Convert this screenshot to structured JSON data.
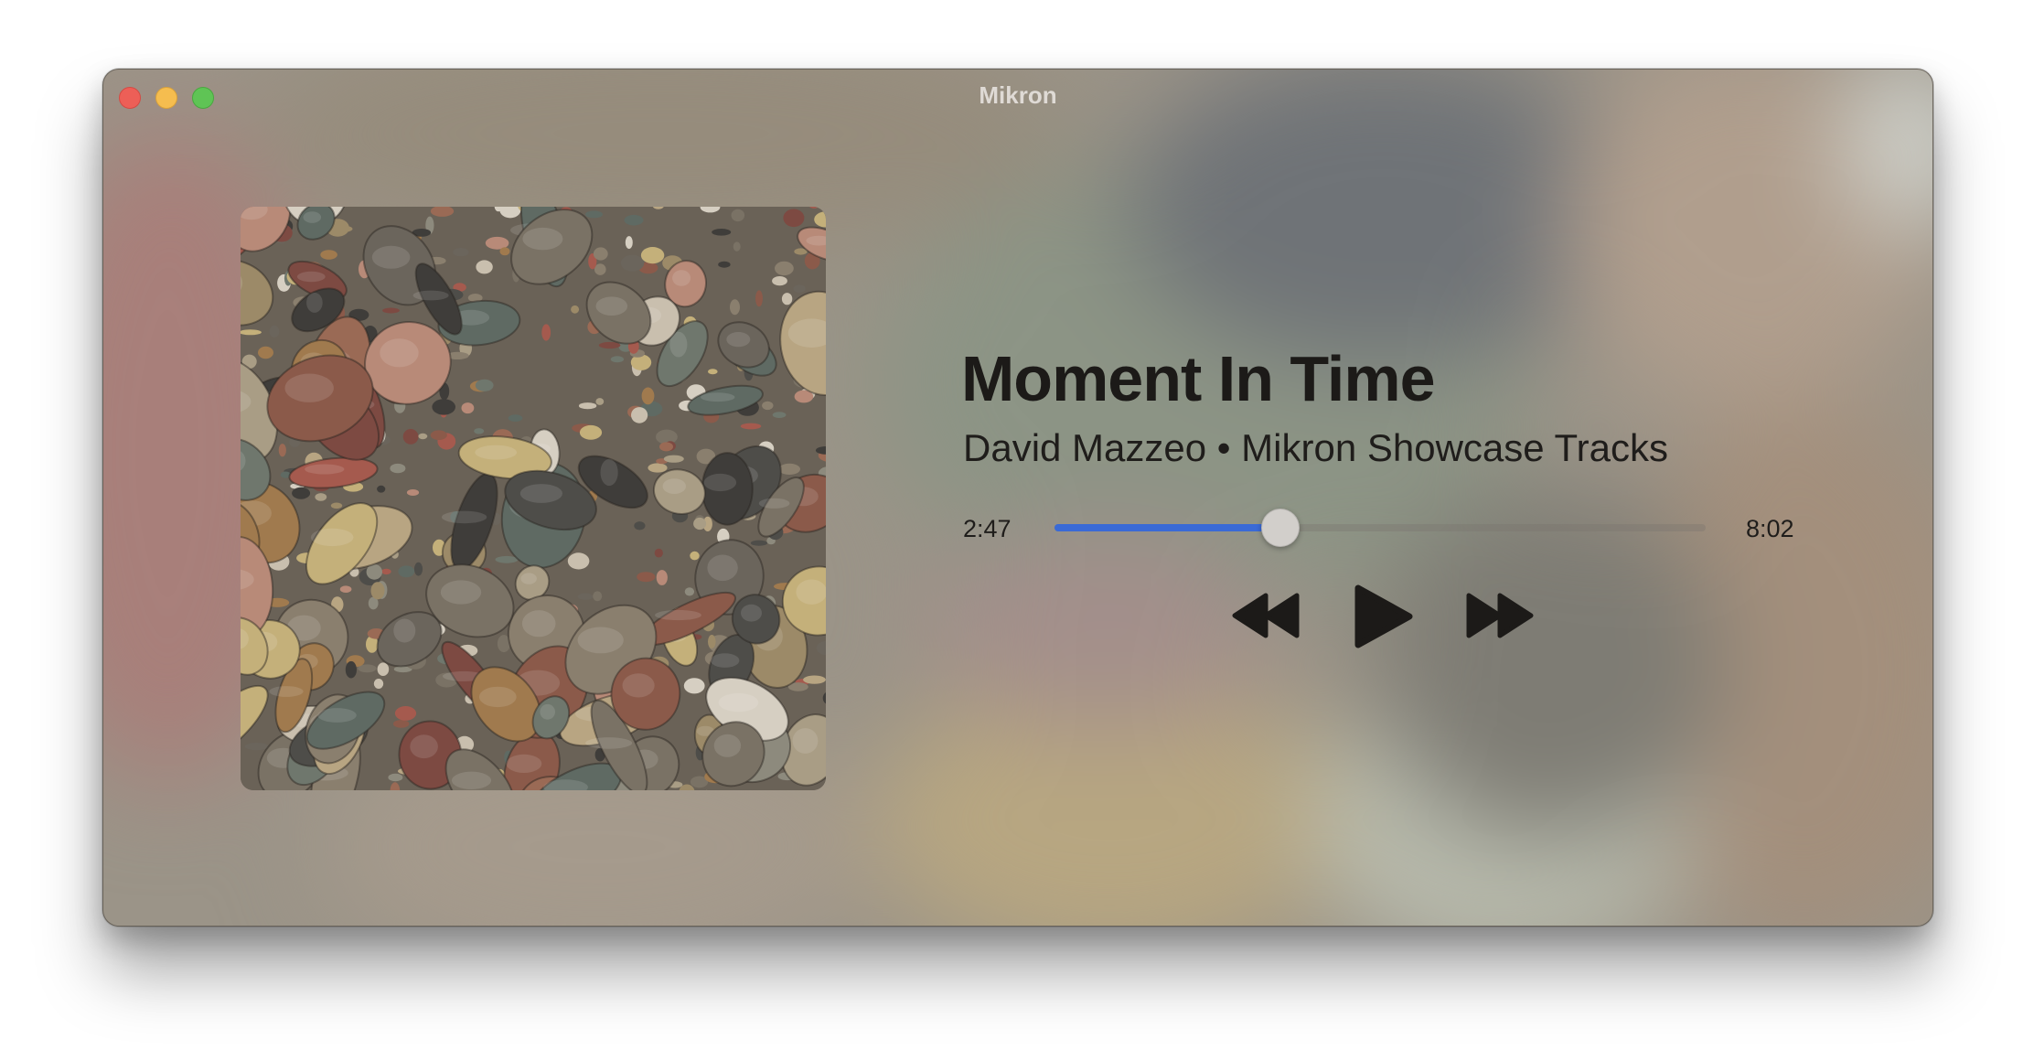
{
  "window": {
    "title": "Mikron"
  },
  "track": {
    "title": "Moment In Time",
    "subtitle": "David Mazzeo • Mikron Showcase Tracks",
    "artist": "David Mazzeo",
    "album": "Mikron Showcase Tracks"
  },
  "progress": {
    "elapsed": "2:47",
    "total": "8:02",
    "fraction": 0.347
  },
  "controls": {
    "rewind_icon": "rewind-icon",
    "play_icon": "play-icon",
    "forward_icon": "fast-forward-icon"
  },
  "colors": {
    "accent": "#3a6ad6",
    "close": "#ed5f57",
    "minimize": "#f5bd4f",
    "maximize": "#5fc455"
  }
}
